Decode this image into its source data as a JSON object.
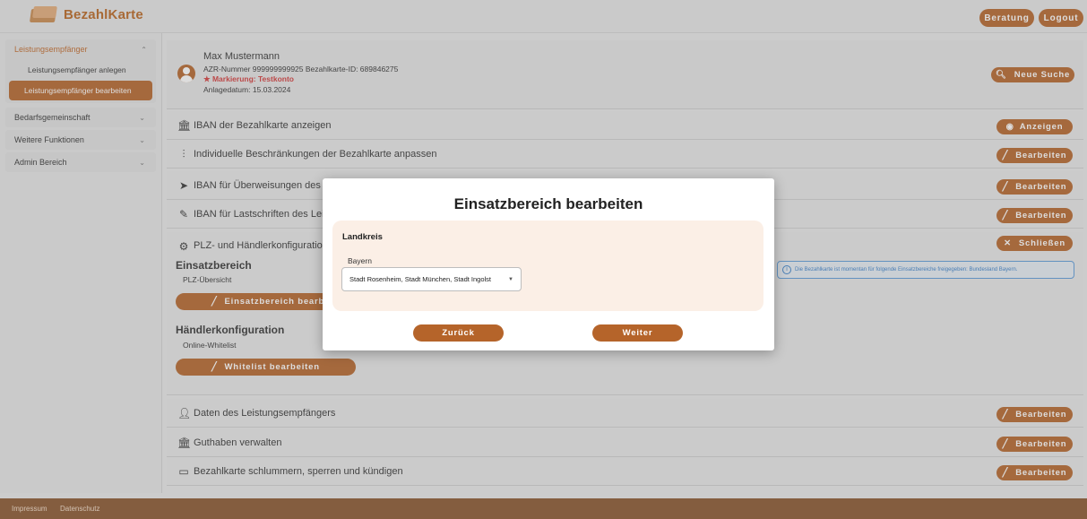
{
  "app": {
    "brand": "BezahlKarte"
  },
  "header": {
    "beratung": "Beratung",
    "logout": "Logout"
  },
  "sidebar": {
    "group_leistung": "Leistungsempfänger",
    "sub_anlegen": "Leistungsempfänger anlegen",
    "sub_bearbeiten": "Leistungsempfänger bearbeiten",
    "bedarf": "Bedarfsgemeinschaft",
    "weitere": "Weitere Funktionen",
    "admin": "Admin Bereich"
  },
  "profile": {
    "name": "Max Mustermann",
    "azr": "AZR-Nummer 999999999925  Bezahlkarte-ID: 689846275",
    "marking": "★ Markierung: Testkonto",
    "date": "Anlagedatum: 15.03.2024",
    "search_btn": "Neue Suche"
  },
  "rows": {
    "iban_show": {
      "label": "IBAN der Bezahlkarte anzeigen",
      "button": "Anzeigen"
    },
    "limits": {
      "label": "Individuelle Beschränkungen der Bezahlkarte anpassen",
      "button": "Bearbeiten"
    },
    "transfer": {
      "label": "IBAN für Überweisungen des Le",
      "button": "Bearbeiten"
    },
    "debit": {
      "label": "IBAN für Lastschriften des Leis",
      "button": "Bearbeiten"
    },
    "data": {
      "label": "Daten des Leistungsempfängers",
      "button": "Bearbeiten"
    },
    "balance": {
      "label": "Guthaben verwalten",
      "button": "Bearbeiten"
    },
    "card": {
      "label": "Bezahlkarte schlummern, sperren und kündigen",
      "button": "Bearbeiten"
    }
  },
  "plz": {
    "header": "PLZ- und Händlerkonfiguration",
    "close_btn": "Schließen",
    "einsatz_title": "Einsatzbereich",
    "einsatz_sub": "PLZ-Übersicht",
    "einsatz_btn": "Einsatzbereich bearbeiten",
    "haendler_title": "Händlerkonfiguration",
    "haendler_sub": "Online-Whitelist",
    "whitelist_btn": "Whitelist bearbeiten",
    "info": "Die Bezahlkarte ist momentan für folgende Einsatzbereiche freigegeben: Bundesland Bayern."
  },
  "dialog": {
    "title": "Einsatzbereich bearbeiten",
    "card_title": "Landkreis",
    "field_label": "Bayern",
    "select_value": "Stadt Rosenheim, Stadt München, Stadt Ingolst",
    "back": "Zurück",
    "next": "Weiter"
  },
  "footer": {
    "impressum": "Impressum",
    "datenschutz": "Datenschutz"
  },
  "colors": {
    "accent": "#b5642a",
    "brand": "#b8651f",
    "footer": "#88542d",
    "marking": "#d33a3a",
    "info": "#3a80c9"
  }
}
